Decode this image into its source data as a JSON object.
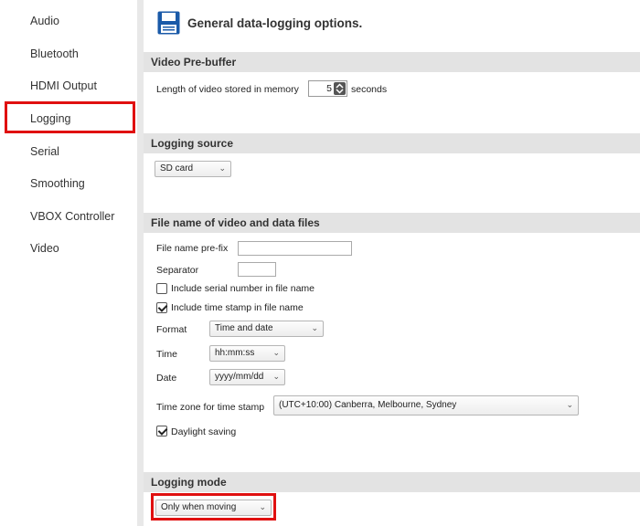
{
  "sidebar": {
    "items": [
      {
        "label": "Audio"
      },
      {
        "label": "Bluetooth"
      },
      {
        "label": "HDMI Output"
      },
      {
        "label": "Logging"
      },
      {
        "label": "Serial"
      },
      {
        "label": "Smoothing"
      },
      {
        "label": "VBOX Controller"
      },
      {
        "label": "Video"
      }
    ],
    "selected": "Logging"
  },
  "header": {
    "icon": "floppy-disk-icon",
    "title": "General data-logging options."
  },
  "video_prebuffer": {
    "heading": "Video Pre-buffer",
    "length_label": "Length of video stored in memory",
    "length_value": "5",
    "length_unit": "seconds"
  },
  "logging_source": {
    "heading": "Logging source",
    "selected": "SD card"
  },
  "file_name": {
    "heading": "File name of video and data files",
    "prefix_label": "File name pre-fix",
    "prefix_value": "",
    "separator_label": "Separator",
    "separator_value": "",
    "serial_label": "Include serial number in file name",
    "serial_checked": false,
    "timestamp_label": "Include time stamp in file name",
    "timestamp_checked": true,
    "format_label": "Format",
    "format_value": "Time and date",
    "time_label": "Time",
    "time_value": "hh:mm:ss",
    "date_label": "Date",
    "date_value": "yyyy/mm/dd",
    "timezone_label": "Time zone for time stamp",
    "timezone_value": "(UTC+10:00) Canberra, Melbourne, Sydney",
    "daylight_label": "Daylight saving",
    "daylight_checked": true
  },
  "logging_mode": {
    "heading": "Logging mode",
    "selected": "Only when moving"
  },
  "colors": {
    "highlight": "#e01010",
    "section_bar": "#e3e3e3",
    "icon_blue": "#1a5aa8"
  }
}
